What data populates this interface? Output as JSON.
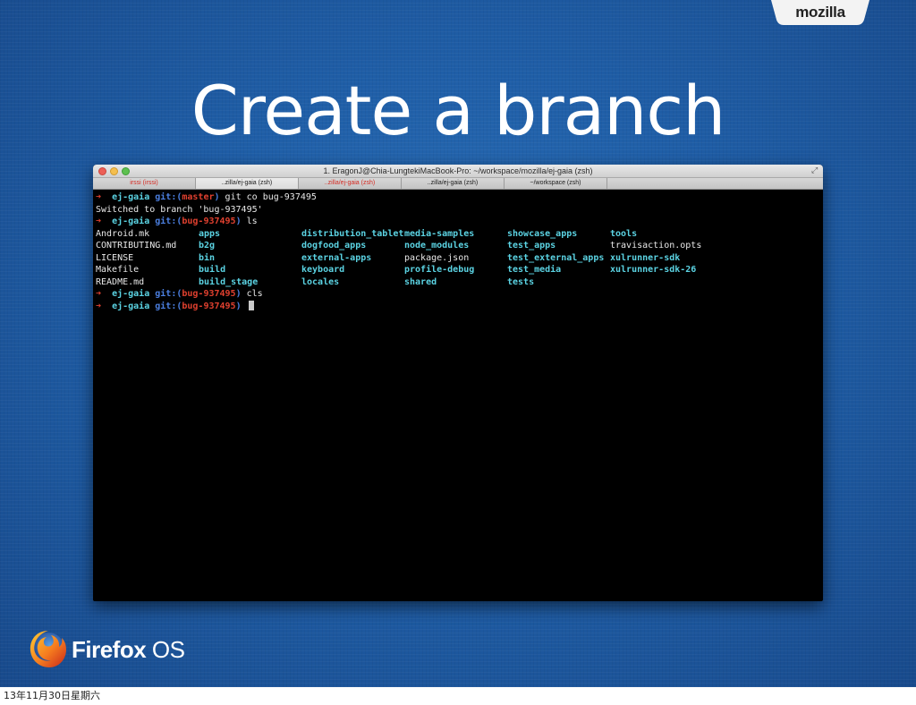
{
  "slide": {
    "title": "Create a branch",
    "mozilla_tab": "mozilla",
    "footer_date": "13年11月30日星期六"
  },
  "brand": {
    "firefox_word": "Firefox",
    "os_word": "OS"
  },
  "window": {
    "title": "1. EragonJ@Chia-LungtekiMacBook-Pro: ~/workspace/mozilla/ej-gaia (zsh)",
    "tabs": [
      {
        "label": "irssi (irssi)",
        "red": true
      },
      {
        "label": "..zilla/ej-gaia (zsh)",
        "red": false
      },
      {
        "label": "..zilla/ej-gaia (zsh)",
        "red": true
      },
      {
        "label": "..zilla/ej-gaia (zsh)",
        "red": false
      },
      {
        "label": "~/workspace (zsh)",
        "red": false
      }
    ]
  },
  "terminal": {
    "prompt_arrow": "➜",
    "cwd": "ej-gaia",
    "git_prefix": "git:(",
    "git_suffix": ")",
    "line1": {
      "branch": "master",
      "cmd": " git co bug-937495"
    },
    "line2": "Switched to branch 'bug-937495'",
    "line3": {
      "branch": "bug-937495",
      "cmd": " ls"
    },
    "ls_rows": [
      [
        {
          "text": "Android.mk",
          "dir": false
        },
        {
          "text": "apps",
          "dir": true
        },
        {
          "text": "distribution_tablet",
          "dir": true
        },
        {
          "text": "media-samples",
          "dir": true
        },
        {
          "text": "showcase_apps",
          "dir": true
        },
        {
          "text": "tools",
          "dir": true
        }
      ],
      [
        {
          "text": "CONTRIBUTING.md",
          "dir": false
        },
        {
          "text": "b2g",
          "dir": true
        },
        {
          "text": "dogfood_apps",
          "dir": true
        },
        {
          "text": "node_modules",
          "dir": true
        },
        {
          "text": "test_apps",
          "dir": true
        },
        {
          "text": "travisaction.opts",
          "dir": false
        }
      ],
      [
        {
          "text": "LICENSE",
          "dir": false
        },
        {
          "text": "bin",
          "dir": true
        },
        {
          "text": "external-apps",
          "dir": true
        },
        {
          "text": "package.json",
          "dir": false
        },
        {
          "text": "test_external_apps",
          "dir": true
        },
        {
          "text": "xulrunner-sdk",
          "dir": true
        }
      ],
      [
        {
          "text": "Makefile",
          "dir": false
        },
        {
          "text": "build",
          "dir": true
        },
        {
          "text": "keyboard",
          "dir": true
        },
        {
          "text": "profile-debug",
          "dir": true
        },
        {
          "text": "test_media",
          "dir": true
        },
        {
          "text": "xulrunner-sdk-26",
          "dir": true
        }
      ],
      [
        {
          "text": "README.md",
          "dir": false
        },
        {
          "text": "build_stage",
          "dir": true
        },
        {
          "text": "locales",
          "dir": true
        },
        {
          "text": "shared",
          "dir": true
        },
        {
          "text": "tests",
          "dir": true
        }
      ]
    ],
    "line4": {
      "branch": "bug-937495",
      "cmd": " cls"
    },
    "line5": {
      "branch": "bug-937495",
      "cmd": " "
    }
  }
}
